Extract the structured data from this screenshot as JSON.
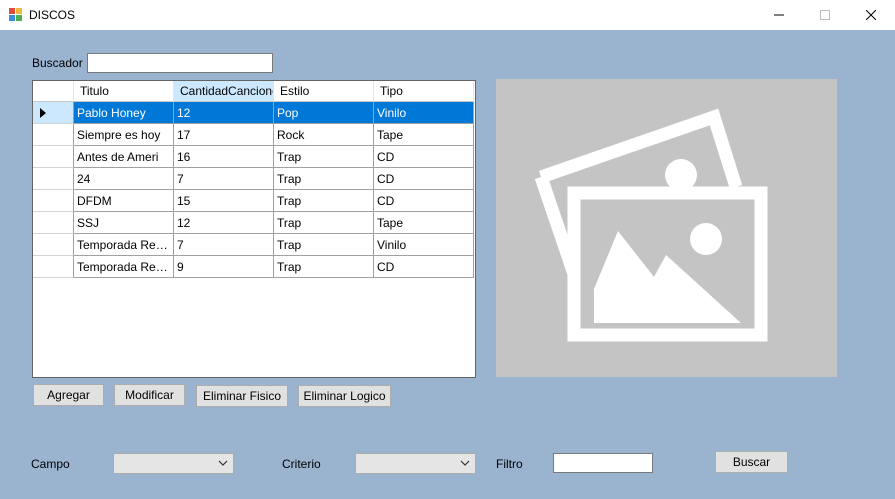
{
  "window": {
    "title": "DISCOS",
    "minimize_glyph": "—",
    "maximize_glyph": "☐",
    "close_glyph": "✕"
  },
  "search": {
    "label": "Buscador",
    "value": ""
  },
  "grid": {
    "columns": [
      "Titulo",
      "CantidadCanciones",
      "Estilo",
      "Tipo"
    ],
    "selected_column": 1,
    "selected_row": 0,
    "rows": [
      [
        "Pablo Honey",
        "12",
        "Pop",
        "Vinilo"
      ],
      [
        "Siempre es hoy",
        "17",
        "Rock",
        "Tape"
      ],
      [
        "Antes de Ameri",
        "16",
        "Trap",
        "CD"
      ],
      [
        "24",
        "7",
        "Trap",
        "CD"
      ],
      [
        "DFDM",
        "15",
        "Trap",
        "CD"
      ],
      [
        "SSJ",
        "12",
        "Trap",
        "Tape"
      ],
      [
        "Temporada Regg...",
        "7",
        "Trap",
        "Vinilo"
      ],
      [
        "Temporada Regg...",
        "9",
        "Trap",
        "CD"
      ]
    ]
  },
  "image_preview": {
    "icon": "image-placeholder-icon"
  },
  "actions": {
    "add": "Agregar",
    "modify": "Modificar",
    "delete_physical": "Eliminar Fisico",
    "delete_logical": "Eliminar Logico"
  },
  "filter": {
    "field_label": "Campo",
    "field_value": "",
    "criteria_label": "Criterio",
    "criteria_value": "",
    "filter_label": "Filtro",
    "filter_value": "",
    "search_button": "Buscar"
  },
  "colors": {
    "client_background": "#9ab3cf",
    "selection": "#0078d7",
    "header_highlight": "#cce8ff"
  }
}
